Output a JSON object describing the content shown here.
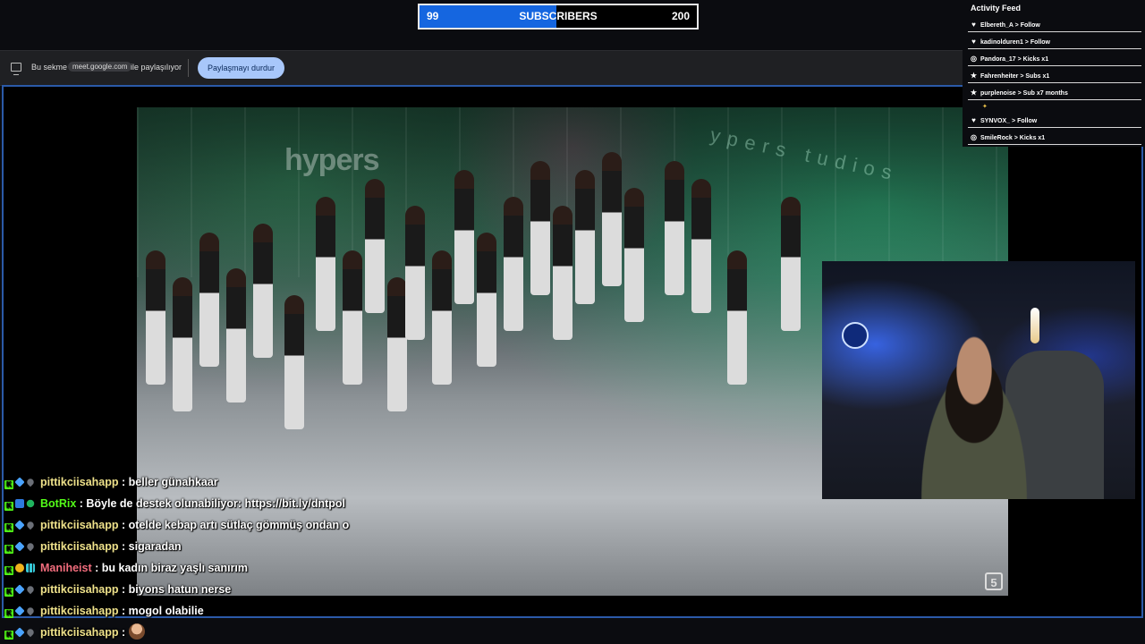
{
  "subscriber_goal": {
    "current": "99",
    "label": "SUBSCRIBERS",
    "target": "200",
    "progress_fraction": 0.495
  },
  "share_bar": {
    "text_before": "Bu sekme",
    "host": "meet.google.com",
    "text_after": "ile paylaşılıyor",
    "stop_button": "Paylaşmayı durdur"
  },
  "video": {
    "logo_left": "hypers",
    "logo_right": "ypers tudios",
    "badge": "5"
  },
  "activity_feed": {
    "title": "Activity Feed",
    "items": [
      {
        "icon": "heart-icon",
        "glyph": "♥",
        "user": "Elbereth_A",
        "action": "Follow"
      },
      {
        "icon": "heart-icon",
        "glyph": "♥",
        "user": "kadinolduren1",
        "action": "Follow"
      },
      {
        "icon": "kick-icon",
        "glyph": "◎",
        "user": "Pandora_17",
        "action": "Kicks x1"
      },
      {
        "icon": "star-icon",
        "glyph": "★",
        "user": "Fahrenheiter",
        "action": "Subs x1"
      },
      {
        "icon": "star-icon",
        "glyph": "★",
        "user": "purplenoise",
        "action": "Sub x7 months"
      },
      {
        "icon": "heart-icon",
        "glyph": "♥",
        "user": "SYNVOX_",
        "action": "Follow"
      },
      {
        "icon": "kick-icon",
        "glyph": "◎",
        "user": "SmileRock",
        "action": "Kicks x1"
      }
    ]
  },
  "chat": [
    {
      "badges": [
        "k",
        "cube",
        "drop"
      ],
      "user": "pittikciisahapp",
      "user_color": "#eee18a",
      "message": "beller günahkaar"
    },
    {
      "badges": [
        "k",
        "bot",
        "check"
      ],
      "user": "BotRix",
      "user_color": "#53fc18",
      "message": "Böyle de destek olunabiliyor: https://bit.ly/dntpol"
    },
    {
      "badges": [
        "k",
        "cube",
        "drop"
      ],
      "user": "pittikciisahapp",
      "user_color": "#eee18a",
      "message": "otelde kebap artı sütlaç gömmüş ondan o"
    },
    {
      "badges": [
        "k",
        "cube",
        "drop"
      ],
      "user": "pittikciisahapp",
      "user_color": "#eee18a",
      "message": "sigaradan"
    },
    {
      "badges": [
        "k",
        "gold",
        "grid"
      ],
      "user": "Maniheist",
      "user_color": "#f26d7d",
      "message": "bu kadın biraz yaşlı sanırım"
    },
    {
      "badges": [
        "k",
        "cube",
        "drop"
      ],
      "user": "pittikciisahapp",
      "user_color": "#eee18a",
      "message": "biyons hatun nerse"
    },
    {
      "badges": [
        "k",
        "cube",
        "drop"
      ],
      "user": "pittikciisahapp",
      "user_color": "#eee18a",
      "message": "mogol olabilie"
    },
    {
      "badges": [
        "k",
        "cube",
        "drop"
      ],
      "user": "pittikciisahapp",
      "user_color": "#eee18a",
      "message": "",
      "emote": "emote-icon"
    }
  ],
  "colors": {
    "accent_blue": "#1566e0",
    "share_button": "#a8c7fa",
    "frame_border": "#2b5aa8",
    "kick_green": "#53fc18"
  }
}
